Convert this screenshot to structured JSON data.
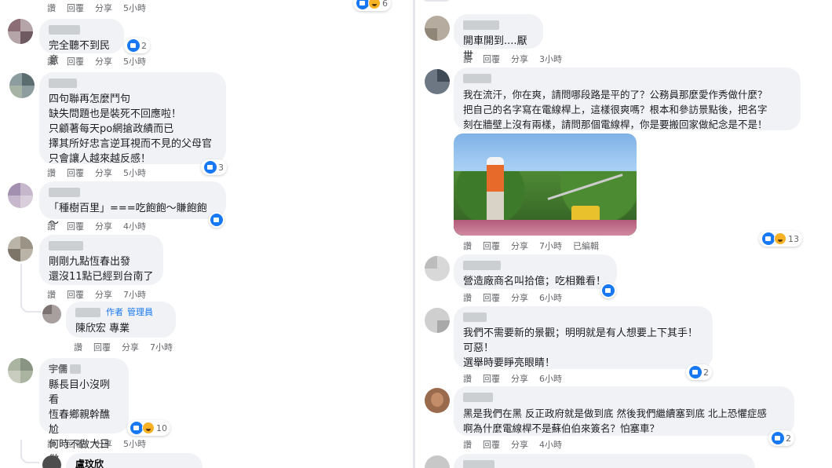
{
  "actions": {
    "like": "讚",
    "reply": "回覆",
    "share": "分享",
    "edited": "已編輯"
  },
  "left": {
    "top_actions": {
      "time": "5小時",
      "reaction_count": "6"
    },
    "c1": {
      "text": "完全聽不到民意",
      "time": "5小時",
      "reaction_count": "2"
    },
    "c2": {
      "text": "四句聯再怎麼鬥句\n缺失問題也是裝死不回應啦！\n只顧著每天po網搶政績而已\n擇其所好忠言逆耳視而不見的父母官\n只會讓人越來越反感！",
      "time": "5小時",
      "reaction_count": "3"
    },
    "c3": {
      "text": "「種樹百里」===吃飽飽～賺飽飽～",
      "time": "4小時"
    },
    "c4": {
      "text": "剛剛九點恆春出發\n還沒11點已經到台南了",
      "time": "7小時"
    },
    "r1": {
      "badge_author": "作者",
      "badge_admin": "管理員",
      "text": "陳欣宏 專業",
      "time": "7小時"
    },
    "c5": {
      "name_fragment": "宇儒",
      "text": "縣長目小沒咧看\n恆春鄉親幹醮尬\n何時不做大日做\n破格政府",
      "time": "5小時",
      "reaction_count": "10"
    },
    "c6": {
      "name": "盧玟欣"
    }
  },
  "right": {
    "c1": {
      "text": "開車開到....厭世",
      "time": "3小時"
    },
    "c2": {
      "text": "我在流汗，你在爽，請問哪段路是平的了？公務員那麼愛作秀做什麼？\n把自己的名字寫在電線桿上，這樣很爽嗎？根本和參訪景點後，把名字\n刻在牆壁上沒有兩樣，請問那個電線桿，你是要搬回家做紀念是不是！",
      "time": "7小時",
      "reaction_count": "13"
    },
    "c3": {
      "text": "營造廠商名叫拾億；吃相難看！",
      "time": "6小時"
    },
    "c4": {
      "text": "我們不需要新的景觀；明明就是有人想要上下其手！\n可惡！\n選舉時要睜亮眼睛！",
      "time": "6小時",
      "reaction_count": "2"
    },
    "c5": {
      "text": "黑是我們在黑 反正政府就是做到底 然後我們繼續塞到底 北上恐懼症感\n啊為什麼電線桿不是蘇伯伯來簽名？怕塞車？",
      "time": "4小時",
      "reaction_count": "2"
    }
  },
  "colors": {
    "bubble": "#f0f2f5",
    "like_blue": "#1877f2",
    "haha_yellow": "#f7b125",
    "meta_gray": "#65676b"
  }
}
